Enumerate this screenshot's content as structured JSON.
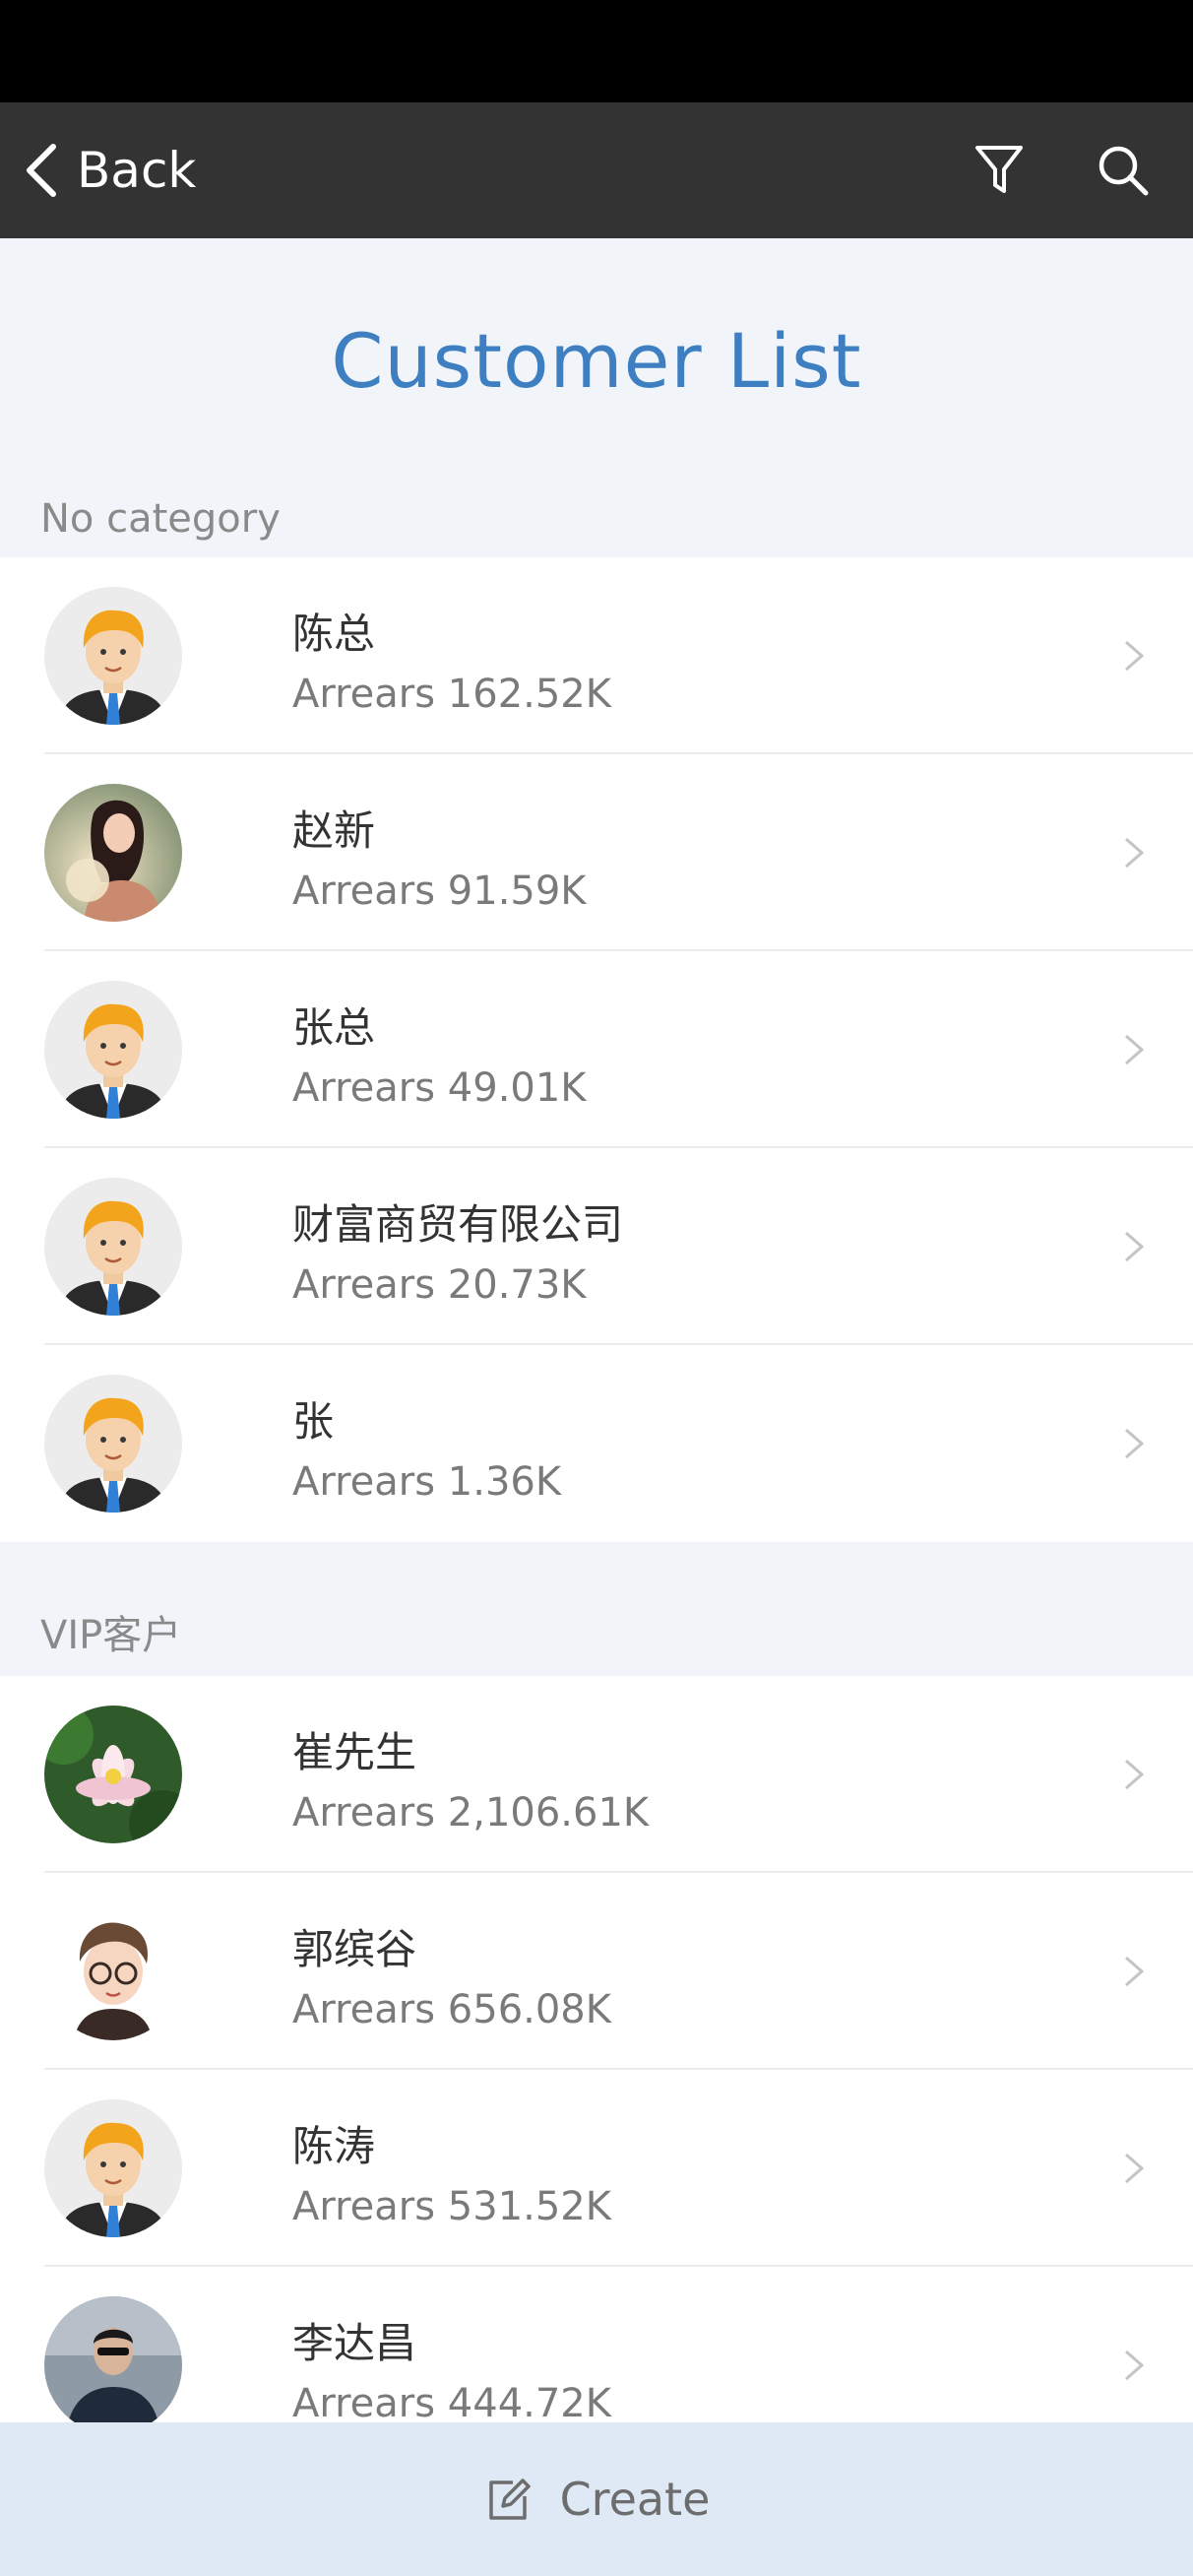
{
  "nav": {
    "back_label": "Back",
    "filter_icon": "filter-icon",
    "search_icon": "search-icon"
  },
  "page": {
    "title": "Customer List"
  },
  "sections": [
    {
      "title": "No category",
      "items": [
        {
          "name": "陈总",
          "arrears": "Arrears 162.52K",
          "avatar": "default-businessman-avatar"
        },
        {
          "name": "赵新",
          "arrears": "Arrears 91.59K",
          "avatar": "woman-photo-avatar"
        },
        {
          "name": "张总",
          "arrears": "Arrears 49.01K",
          "avatar": "default-businessman-avatar"
        },
        {
          "name": "财富商贸有限公司",
          "arrears": "Arrears 20.73K",
          "avatar": "default-businessman-avatar"
        },
        {
          "name": "张",
          "arrears": "Arrears 1.36K",
          "avatar": "default-businessman-avatar"
        }
      ]
    },
    {
      "title": "VIP客户",
      "items": [
        {
          "name": "崔先生",
          "arrears": "Arrears 2,106.61K",
          "avatar": "lotus-photo-avatar"
        },
        {
          "name": "郭缤谷",
          "arrears": "Arrears 656.08K",
          "avatar": "cartoon-boy-avatar"
        },
        {
          "name": "陈涛",
          "arrears": "Arrears 531.52K",
          "avatar": "default-businessman-avatar"
        },
        {
          "name": "李达昌",
          "arrears": "Arrears 444.72K",
          "avatar": "man-sunglasses-photo-avatar"
        }
      ]
    }
  ],
  "bottom": {
    "create_label": "Create",
    "create_icon": "edit-icon"
  },
  "colors": {
    "nav_bg": "#333333",
    "title": "#3e7fc1",
    "bottom_bar": "#dfe9f6",
    "page_bg": "#f1f5fa"
  }
}
